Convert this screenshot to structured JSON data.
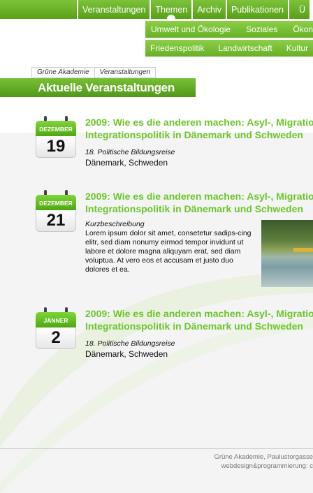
{
  "topnav": {
    "items": [
      "Veranstaltungen",
      "Themen",
      "Archiv",
      "Publikationen",
      "Ü"
    ],
    "active_index": 1
  },
  "subnav": {
    "row1": [
      "Umwelt und Ökologie",
      "Soziales",
      "Ökon"
    ],
    "row2": [
      "Friedenspolitik",
      "Landwirtschaft",
      "Kultur"
    ]
  },
  "breadcrumb": [
    "Grüne Akademie",
    "Veranstaltungen"
  ],
  "page_title": "Aktuelle Veranstaltungen",
  "events": [
    {
      "month": "DEZEMBER",
      "day": "19",
      "title_line1": "2009: Wie es die anderen machen: Asyl-, Migratio",
      "title_line2": "Integrationspolitik in Dänemark und Schweden",
      "subtitle": "18. Politische Bildungsreise",
      "location": "Dänemark, Schweden"
    },
    {
      "month": "DEZEMBER",
      "day": "21",
      "title_line1": "2009: Wie es die anderen machen: Asyl-, Migratio",
      "title_line2": "Integrationspolitik in Dänemark und Schweden",
      "subtitle": "Kurzbeschreibung",
      "description": "Lorem ipsum dolor sit amet, consetetur sadips-cing elitr, sed diam nonumy eirmod tempor invidunt ut labore et dolore magna aliquyam erat, sed diam voluptua. At vero eos et accusam et justo duo dolores et ea."
    },
    {
      "month": "JÄNNER",
      "day": "2",
      "title_line1": "2009: Wie es die anderen machen: Asyl-, Migratio",
      "title_line2": "Integrationspolitik in Dänemark und Schweden",
      "subtitle": "18. Politische Bildungsreise",
      "location": "Dänemark, Schweden"
    }
  ],
  "footer": {
    "line1": "Grüne Akademie, Paulustorgasse",
    "line2": "webdesign&programmierung: c"
  },
  "colors": {
    "brand_green": "#6cc52b",
    "nav_green": "#5aa117",
    "background_gray": "#f4f4f4"
  }
}
